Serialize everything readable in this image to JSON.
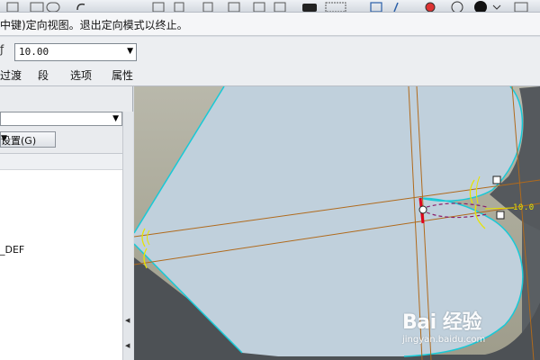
{
  "message_bar": {
    "text": "中键)定向视图。退出定向模式以终止。"
  },
  "dashboard": {
    "dimension_value": "10.00"
  },
  "tabs": [
    {
      "label": "过渡"
    },
    {
      "label": "段"
    },
    {
      "label": "选项"
    },
    {
      "label": "属性"
    }
  ],
  "left_panel": {
    "settings_button": "设置(G)",
    "list_item": "_DEF"
  },
  "viewport": {
    "dimension_label": "10.0"
  },
  "watermark": {
    "logo": "Bai 经验",
    "url": "jingyan.baidu.com"
  },
  "colors": {
    "part_face": "#c0d0dc",
    "part_side": "#5a5f63",
    "edge_highlight": "#19c9d6",
    "sketch_line": "#b06a1c",
    "selection": "#e8e400",
    "handle_red": "#e0001c"
  }
}
